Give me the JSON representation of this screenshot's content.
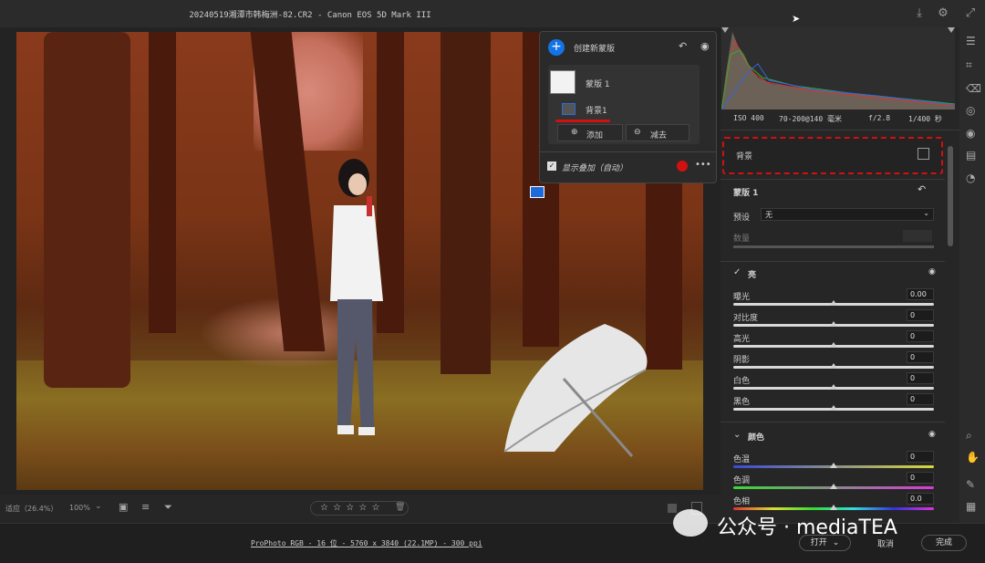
{
  "window": {
    "title": "20240519湘潭市韩梅洲-82.CR2 -  Canon EOS 5D Mark III"
  },
  "mask_panel": {
    "create_label": "创建新蒙版",
    "mask_name": "蒙版 1",
    "sub_name": "背景1",
    "add_label": "添加",
    "subtract_label": "减去",
    "overlay_label": "显示叠加（自动）",
    "more": "•••"
  },
  "histogram": {
    "iso": "ISO 400",
    "lens": "70-200@140 毫米",
    "aperture": "f/2.8",
    "shutter": "1/400 秒"
  },
  "right": {
    "selected_mask": "背景",
    "mask_title": "蒙版 1",
    "preset_label": "预设",
    "preset_value": "无",
    "amount_label": "数量",
    "light": {
      "title": "亮",
      "sliders": [
        {
          "label": "曝光",
          "value": "0.00",
          "pos": 0.5
        },
        {
          "label": "对比度",
          "value": "0",
          "pos": 0.5
        },
        {
          "label": "高光",
          "value": "0",
          "pos": 0.5
        },
        {
          "label": "阴影",
          "value": "0",
          "pos": 0.5
        },
        {
          "label": "白色",
          "value": "0",
          "pos": 0.5
        },
        {
          "label": "黑色",
          "value": "0",
          "pos": 0.5
        }
      ]
    },
    "color": {
      "title": "颜色",
      "sliders": [
        {
          "label": "色温",
          "value": "0",
          "pos": 0.5
        },
        {
          "label": "色调",
          "value": "0",
          "pos": 0.5
        },
        {
          "label": "色相",
          "value": "0.0",
          "pos": 0.5
        }
      ]
    }
  },
  "bottom": {
    "zoom_fit": "适应（26.4%）",
    "zoom": "100%",
    "stars": "☆ ☆ ☆ ☆ ☆"
  },
  "footer": {
    "info": "ProPhoto RGB - 16 位 - 5760 x 3840 (22.1MP) - 300 ppi",
    "open": "打开",
    "cancel": "取消",
    "done": "完成",
    "watermark": "公众号 · mediaTEA"
  },
  "colors": {
    "accent": "#1473e6",
    "overlay_dot": "#d11010",
    "selection": "#d11010"
  }
}
